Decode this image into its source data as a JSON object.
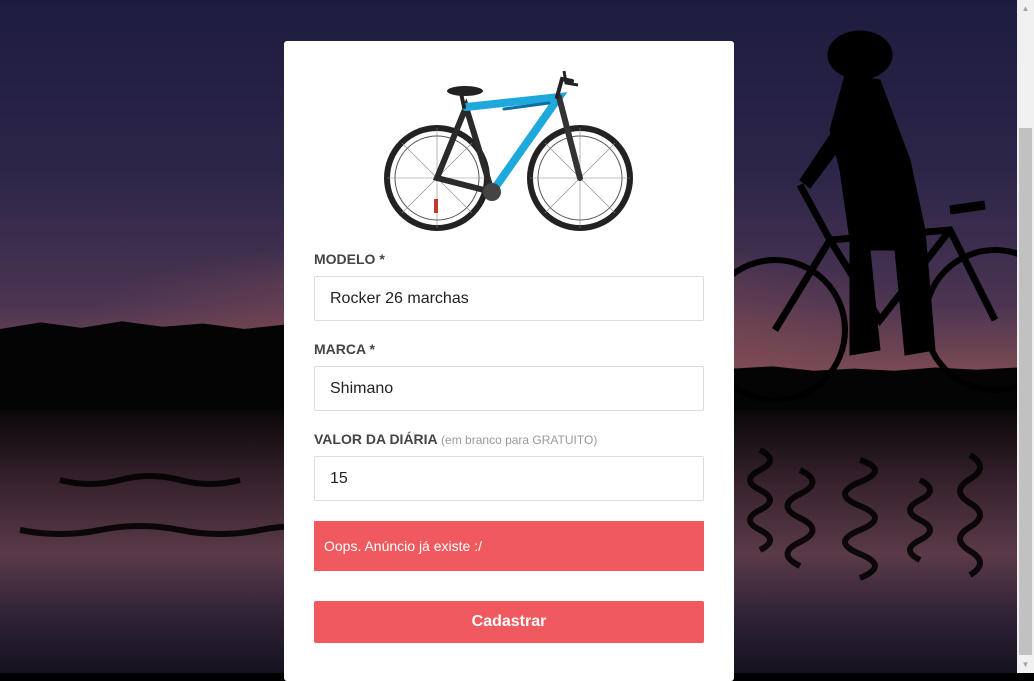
{
  "form": {
    "modelo_label": "MODELO *",
    "modelo_value": "Rocker 26 marchas",
    "marca_label": "MARCA *",
    "marca_value": "Shimano",
    "valor_label": "VALOR DA DIÁRIA",
    "valor_hint": "(em branco para GRATUITO)",
    "valor_value": "15",
    "error_message": "Oops. Anúncio já existe :/",
    "submit_label": "Cadastrar"
  },
  "colors": {
    "accent": "#f05a5e",
    "bike_frame_accent": "#1fa8dc"
  },
  "icons": {
    "scroll_up": "▲",
    "scroll_down": "▼"
  }
}
